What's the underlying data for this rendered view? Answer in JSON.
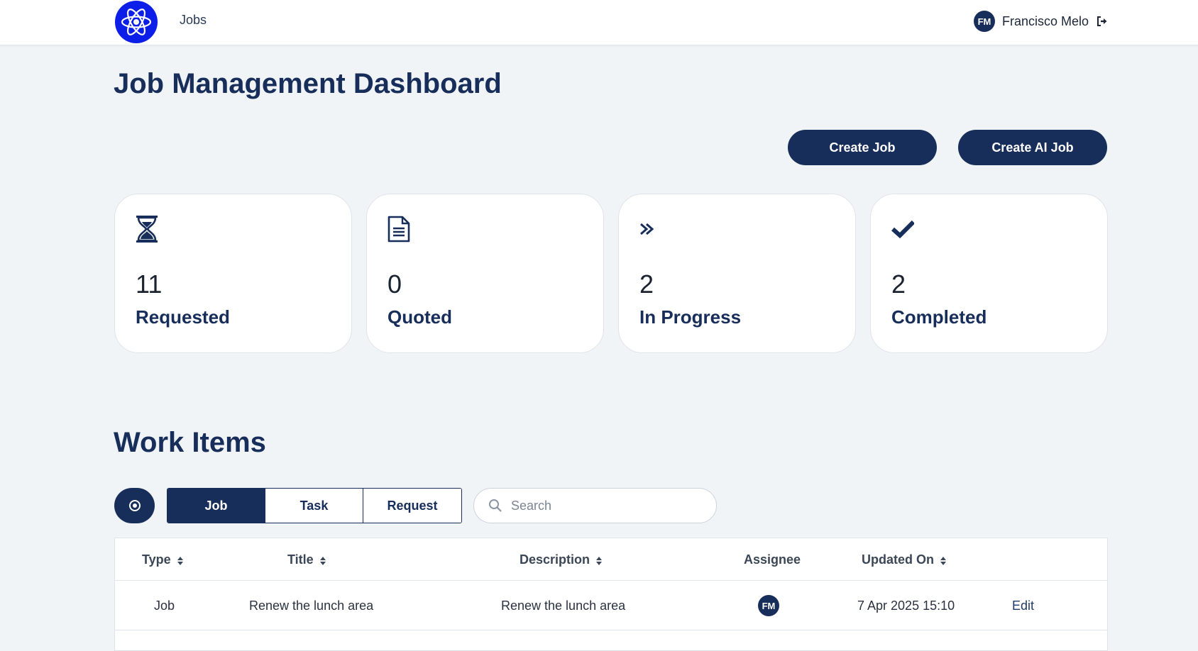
{
  "nav": {
    "logo_icon": "atom-icon",
    "jobs_link": "Jobs",
    "user_initials": "FM",
    "user_name": "Francisco Melo",
    "logout_icon": "sign-out-icon"
  },
  "page": {
    "title": "Job Management Dashboard",
    "create_job": "Create Job",
    "create_ai_job": "Create AI Job"
  },
  "stats": [
    {
      "icon": "hourglass-icon",
      "count": "11",
      "label": "Requested"
    },
    {
      "icon": "document-icon",
      "count": "0",
      "label": "Quoted"
    },
    {
      "icon": "double-chevron-right-icon",
      "count": "2",
      "label": "In Progress"
    },
    {
      "icon": "checkmark-icon",
      "count": "2",
      "label": "Completed"
    }
  ],
  "work_items": {
    "title": "Work Items",
    "filter_icon": "target-icon",
    "tabs": [
      "Job",
      "Task",
      "Request"
    ],
    "active_tab": "Job",
    "search_placeholder": "Search",
    "columns": [
      "Type",
      "Title",
      "Description",
      "Assignee",
      "Updated On"
    ],
    "rows": [
      {
        "type": "Job",
        "title": "Renew the lunch area",
        "description": "Renew the lunch area",
        "assignee": "FM",
        "updated_on": "7 Apr 2025 15:10",
        "action": "Edit"
      }
    ]
  },
  "colors": {
    "primary": "#172d5a",
    "logo_blue": "#0c1ee8",
    "background": "#f1f4f7"
  }
}
